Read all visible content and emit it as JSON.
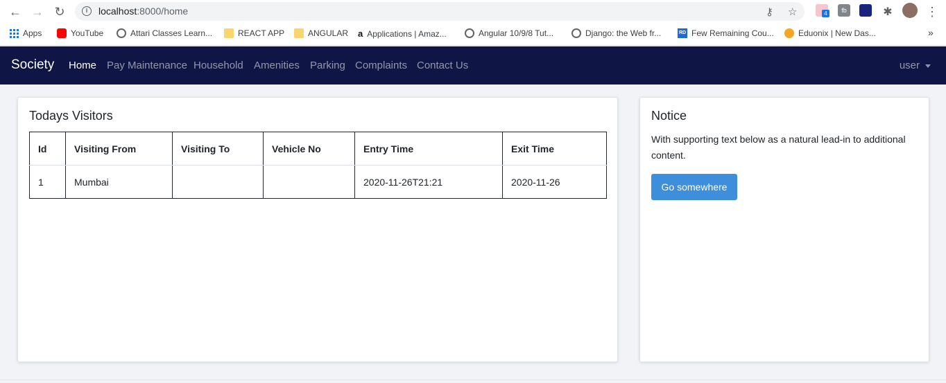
{
  "browser": {
    "url_host": "localhost",
    "url_path": ":8000/home",
    "bookmarks": [
      {
        "label": "Apps",
        "icon": "apps-grid-icon"
      },
      {
        "label": "YouTube",
        "icon": "youtube-icon"
      },
      {
        "label": "Attari Classes Learn...",
        "icon": "globe-icon"
      },
      {
        "label": "REACT APP",
        "icon": "folder-icon"
      },
      {
        "label": "ANGULAR",
        "icon": "folder-icon"
      },
      {
        "label": "Applications | Amaz...",
        "icon": "amazon-icon"
      },
      {
        "label": "Angular 10/9/8 Tut...",
        "icon": "globe-icon"
      },
      {
        "label": "Django: the Web fr...",
        "icon": "globe-icon"
      },
      {
        "label": "Few Remaining Cou...",
        "icon": "rd-icon"
      },
      {
        "label": "Eduonix | New Das...",
        "icon": "eduonix-icon"
      }
    ],
    "ext_badge": "4"
  },
  "navbar": {
    "brand": "Society",
    "links": [
      "Home",
      "Pay Maintenance",
      "Household",
      "Amenities",
      "Parking",
      "Complaints",
      "Contact Us"
    ],
    "active": "Home",
    "user": "user"
  },
  "visitors": {
    "title": "Todays Visitors",
    "columns": [
      "Id",
      "Visiting From",
      "Visiting To",
      "Vehicle No",
      "Entry Time",
      "Exit Time"
    ],
    "rows": [
      [
        "1",
        "Mumbai",
        "",
        "",
        "2020-11-26T21:21",
        "2020-11-26"
      ]
    ]
  },
  "notice": {
    "title": "Notice",
    "text": "With supporting text below as a natural lead-in to additional content.",
    "button": "Go somewhere"
  },
  "colors": {
    "navbar_bg": "#0f1544",
    "button_bg": "#3d8fdb",
    "page_bg": "#f1f3f7"
  }
}
